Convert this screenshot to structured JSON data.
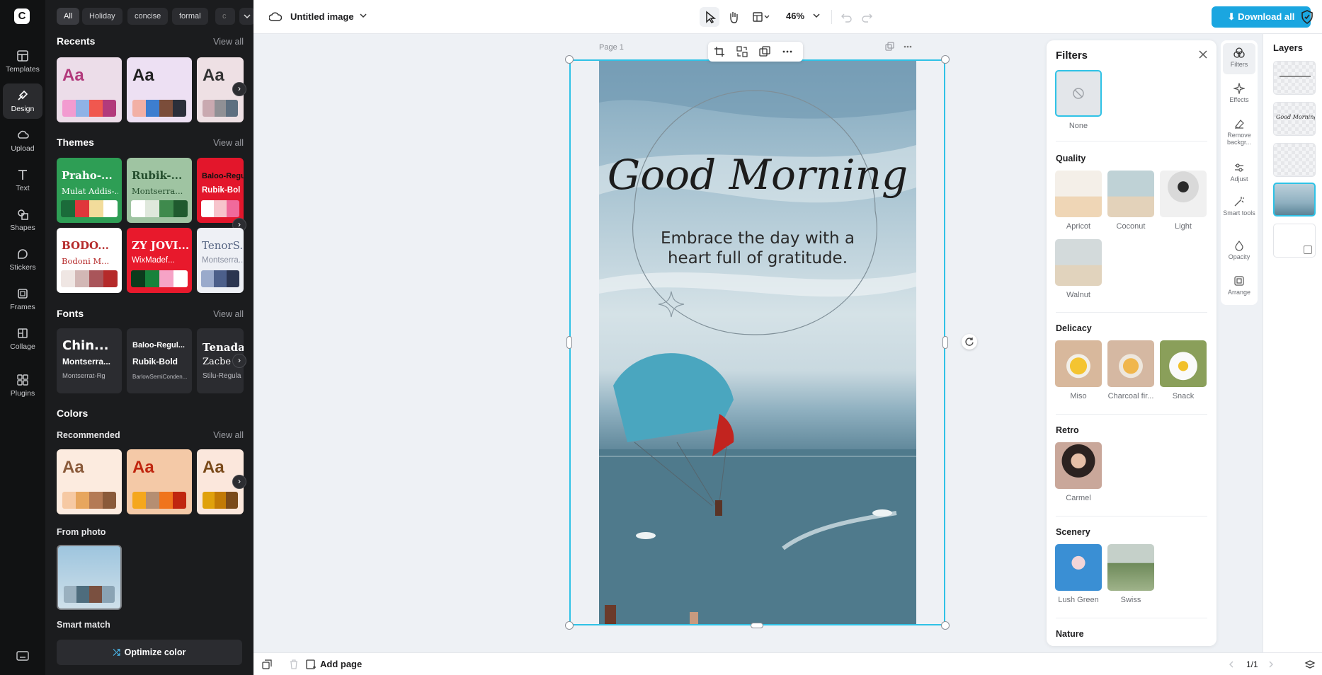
{
  "nav": {
    "items": [
      {
        "label": "Templates",
        "icon": "templates-icon"
      },
      {
        "label": "Design",
        "icon": "design-icon",
        "active": true
      },
      {
        "label": "Upload",
        "icon": "upload-icon"
      },
      {
        "label": "Text",
        "icon": "text-icon"
      },
      {
        "label": "Shapes",
        "icon": "shapes-icon"
      },
      {
        "label": "Stickers",
        "icon": "stickers-icon"
      },
      {
        "label": "Frames",
        "icon": "frames-icon"
      },
      {
        "label": "Collage",
        "icon": "collage-icon"
      },
      {
        "label": "Plugins",
        "icon": "plugins-icon"
      }
    ]
  },
  "design_panel": {
    "chips": [
      "All",
      "Holiday",
      "concise",
      "formal",
      "c"
    ],
    "recents": {
      "title": "Recents",
      "view_all": "View all",
      "card_text": "Aa"
    },
    "themes": {
      "title": "Themes",
      "view_all": "View all",
      "cards": [
        {
          "heading": "Praho-...",
          "sub": "Mulat Addis-..."
        },
        {
          "heading": "Rubik-...",
          "sub": "Montserra..."
        },
        {
          "heading": "Baloo-Regu",
          "sub": "Rubik-Bol"
        },
        {
          "heading": "BODO...",
          "sub": "Bodoni M..."
        },
        {
          "heading": "ZY JOVI...",
          "sub": "WixMadef..."
        },
        {
          "heading": "TenorS...",
          "sub": "Montserra..."
        }
      ]
    },
    "fonts": {
      "title": "Fonts",
      "view_all": "View all",
      "cards": [
        {
          "l1": "Chin...",
          "l2": "Montserra...",
          "l3": "Montserrat-Rg"
        },
        {
          "l1": "Baloo-Regul...",
          "l2": "Rubik-Bold",
          "l3": "BarlowSemiConden..."
        },
        {
          "l1": "Tenada",
          "l2": "Zacbe",
          "l3": "Stilu-Regula"
        }
      ]
    },
    "colors": {
      "title": "Colors",
      "recommended": "Recommended",
      "view_all": "View all",
      "card_text": "Aa"
    },
    "from_photo": "From photo",
    "smart_match": "Smart match",
    "optimize_button": "Optimize color"
  },
  "topbar": {
    "doc_title": "Untitled image",
    "zoom": "46%",
    "download_label": "Download all"
  },
  "canvas": {
    "page_label": "Page 1",
    "headline": "Good Morning",
    "tagline_line1": "Embrace the day with a",
    "tagline_line2": "heart full of gratitude."
  },
  "filters": {
    "title": "Filters",
    "none_label": "None",
    "groups": [
      {
        "name": "Quality",
        "items": [
          "Apricot",
          "Coconut",
          "Light",
          "Walnut"
        ]
      },
      {
        "name": "Delicacy",
        "items": [
          "Miso",
          "Charcoal fir...",
          "Snack"
        ]
      },
      {
        "name": "Retro",
        "items": [
          "Carmel"
        ]
      },
      {
        "name": "Scenery",
        "items": [
          "Lush Green",
          "Swiss"
        ]
      },
      {
        "name": "Nature",
        "items": []
      }
    ]
  },
  "tools": {
    "items": [
      {
        "label": "Filters",
        "active": true
      },
      {
        "label": "Effects"
      },
      {
        "label": "Remove backgr..."
      },
      {
        "label": "Adjust"
      },
      {
        "label": "Smart tools"
      },
      {
        "label": "Opacity"
      },
      {
        "label": "Arrange"
      }
    ]
  },
  "layers": {
    "title": "Layers",
    "layer_preview_text": "Good Morning"
  },
  "bottombar": {
    "add_page": "Add page",
    "page_count": "1/1"
  },
  "colors": {
    "accent": "#1aa6e0",
    "selection": "#2fc2e6",
    "rail_bg": "#111213",
    "panel_bg": "#1b1c1e"
  }
}
